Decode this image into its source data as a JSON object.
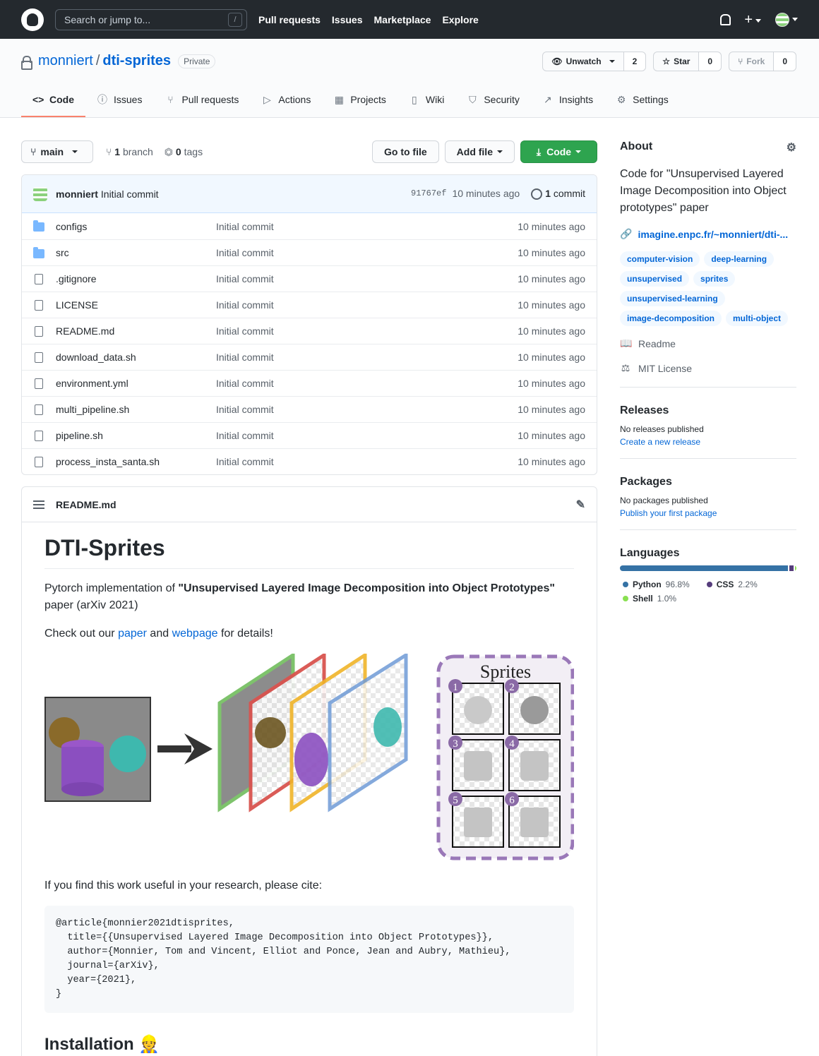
{
  "header": {
    "search_placeholder": "Search or jump to...",
    "search_key": "/",
    "nav": [
      "Pull requests",
      "Issues",
      "Marketplace",
      "Explore"
    ],
    "plus": "+"
  },
  "repo": {
    "owner": "monniert",
    "sep": "/",
    "name": "dti-sprites",
    "visibility": "Private",
    "watch_label": "Unwatch",
    "watch_count": "2",
    "star_label": "Star",
    "star_count": "0",
    "fork_label": "Fork",
    "fork_count": "0"
  },
  "tabs": [
    {
      "label": "Code",
      "icon": "<>"
    },
    {
      "label": "Issues",
      "icon": "ⓘ"
    },
    {
      "label": "Pull requests",
      "icon": "⑂"
    },
    {
      "label": "Actions",
      "icon": "▷"
    },
    {
      "label": "Projects",
      "icon": "▦"
    },
    {
      "label": "Wiki",
      "icon": "▯"
    },
    {
      "label": "Security",
      "icon": "⛉"
    },
    {
      "label": "Insights",
      "icon": "↗"
    },
    {
      "label": "Settings",
      "icon": "⚙"
    }
  ],
  "filebar": {
    "branch": "main",
    "branch_count": "1",
    "branch_word": "branch",
    "tag_count": "0",
    "tag_word": "tags",
    "goto_label": "Go to file",
    "addfile_label": "Add file",
    "code_label": "Code"
  },
  "commit": {
    "author": "monniert",
    "message": "Initial commit",
    "sha": "91767ef",
    "age": "10 minutes ago",
    "count": "1",
    "count_word": "commit"
  },
  "files": [
    {
      "name": "configs",
      "type": "dir",
      "msg": "Initial commit",
      "age": "10 minutes ago"
    },
    {
      "name": "src",
      "type": "dir",
      "msg": "Initial commit",
      "age": "10 minutes ago"
    },
    {
      "name": ".gitignore",
      "type": "file",
      "msg": "Initial commit",
      "age": "10 minutes ago"
    },
    {
      "name": "LICENSE",
      "type": "file",
      "msg": "Initial commit",
      "age": "10 minutes ago"
    },
    {
      "name": "README.md",
      "type": "file",
      "msg": "Initial commit",
      "age": "10 minutes ago"
    },
    {
      "name": "download_data.sh",
      "type": "file",
      "msg": "Initial commit",
      "age": "10 minutes ago"
    },
    {
      "name": "environment.yml",
      "type": "file",
      "msg": "Initial commit",
      "age": "10 minutes ago"
    },
    {
      "name": "multi_pipeline.sh",
      "type": "file",
      "msg": "Initial commit",
      "age": "10 minutes ago"
    },
    {
      "name": "pipeline.sh",
      "type": "file",
      "msg": "Initial commit",
      "age": "10 minutes ago"
    },
    {
      "name": "process_insta_santa.sh",
      "type": "file",
      "msg": "Initial commit",
      "age": "10 minutes ago"
    }
  ],
  "readme": {
    "filename": "README.md",
    "title": "DTI-Sprites",
    "intro_pre": "Pytorch implementation of ",
    "intro_bold": "\"Unsupervised Layered Image Decomposition into Object Prototypes\"",
    "intro_post": " paper (arXiv 2021)",
    "check_pre": "Check out our ",
    "paper_link": "paper",
    "check_mid": " and ",
    "webpage_link": "webpage",
    "check_post": " for details!",
    "figure_sprites_title": "Sprites",
    "figure_numbers": [
      "1",
      "2",
      "3",
      "4",
      "5",
      "6"
    ],
    "cite_text": "If you find this work useful in your research, please cite:",
    "bibtex": "@article{monnier2021dtisprites,\n  title={{Unsupervised Layered Image Decomposition into Object Prototypes}},\n  author={Monnier, Tom and Vincent, Elliot and Ponce, Jean and Aubry, Mathieu},\n  journal={arXiv},\n  year={2021},\n}",
    "installation": "Installation 👷"
  },
  "sidebar": {
    "about_title": "About",
    "description": "Code for \"Unsupervised Layered Image Decomposition into Object prototypes\" paper",
    "website": "imagine.enpc.fr/~monniert/dti-...",
    "topics": [
      "computer-vision",
      "deep-learning",
      "unsupervised",
      "sprites",
      "unsupervised-learning",
      "image-decomposition",
      "multi-object"
    ],
    "readme_label": "Readme",
    "license_label": "MIT License",
    "releases_title": "Releases",
    "releases_none": "No releases published",
    "releases_link": "Create a new release",
    "packages_title": "Packages",
    "packages_none": "No packages published",
    "packages_link": "Publish your first package",
    "languages_title": "Languages",
    "languages": [
      {
        "name": "Python",
        "pct": "96.8%",
        "value": 96.8,
        "color": "#3572A5"
      },
      {
        "name": "CSS",
        "pct": "2.2%",
        "value": 2.2,
        "color": "#563d7c"
      },
      {
        "name": "Shell",
        "pct": "1.0%",
        "value": 1.0,
        "color": "#89e051"
      }
    ]
  }
}
